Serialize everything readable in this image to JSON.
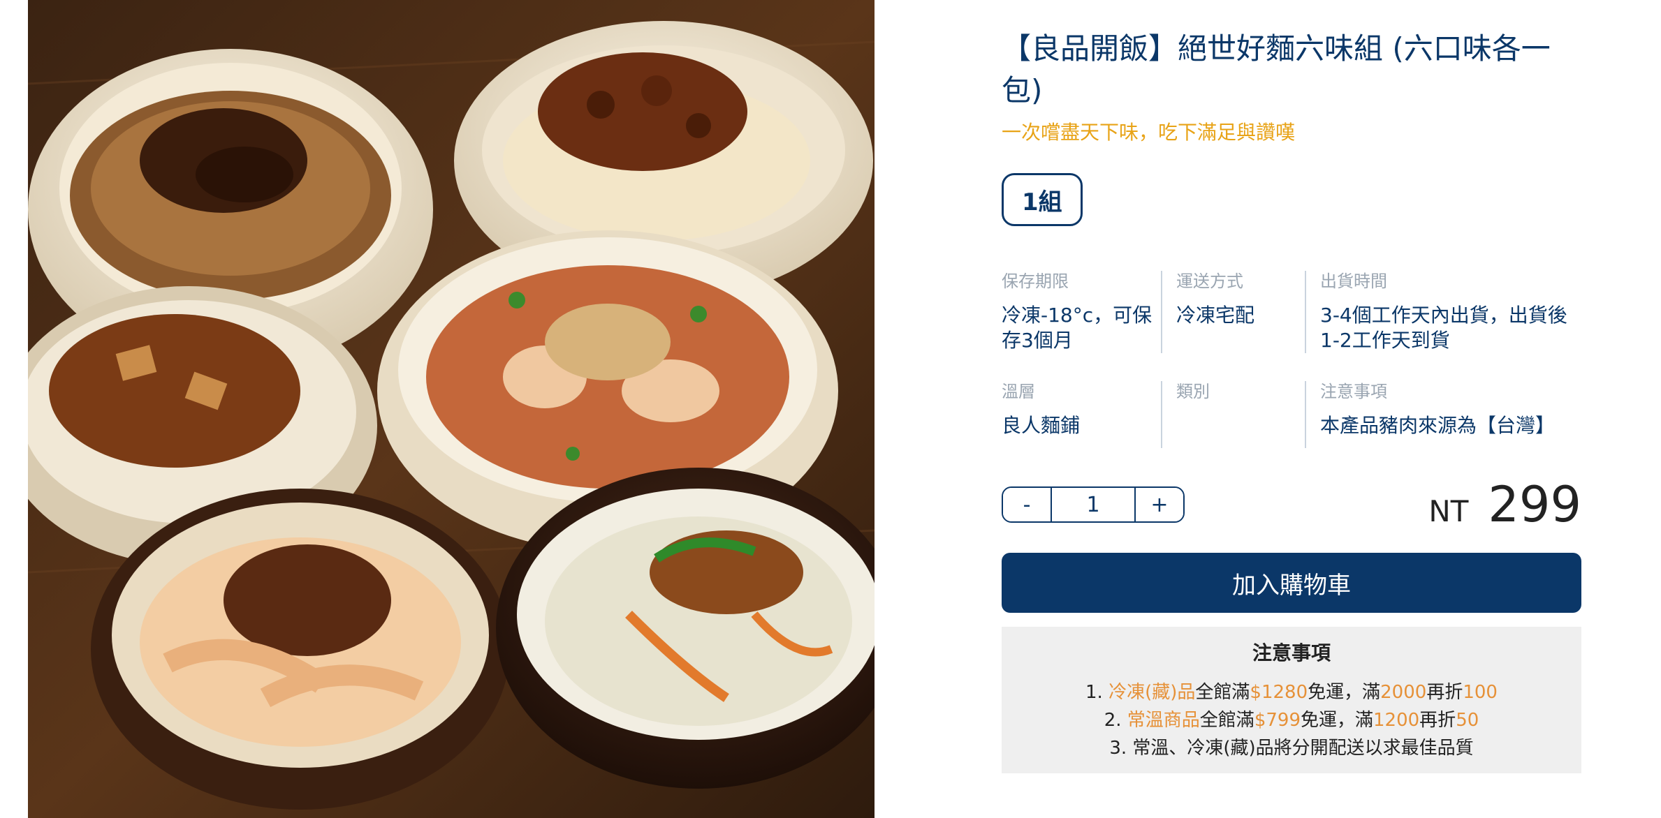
{
  "product": {
    "title": "【良品開飯】絕世好麵六味組 (六口味各一包)",
    "subtitle": "一次嚐盡天下味，吃下滿足與讚嘆",
    "variant": "1組",
    "image_alt": "six bowls of noodles"
  },
  "specs": [
    {
      "label": "保存期限",
      "value": "冷凍-18°c，可保存3個月"
    },
    {
      "label": "運送方式",
      "value": "冷凍宅配"
    },
    {
      "label": "出貨時間",
      "value": "3-4個工作天內出貨，出貨後1-2工作天到貨"
    },
    {
      "label": "溫層",
      "value": "良人麵鋪"
    },
    {
      "label": "類別",
      "value": ""
    },
    {
      "label": "注意事項",
      "value": "本產品豬肉來源為【台灣】"
    }
  ],
  "purchase": {
    "minus": "-",
    "quantity": "1",
    "plus": "+",
    "currency": "NT",
    "price": "299",
    "add_to_cart": "加入購物車"
  },
  "notice": {
    "title": "注意事項",
    "line1": {
      "prefix": "1. ",
      "category": "冷凍(藏)品",
      "text1": "全館滿",
      "threshold": "$1280",
      "text2": "免運，滿",
      "threshold2": "2000",
      "text3": "再折",
      "discount": "100"
    },
    "line2": {
      "prefix": "2. ",
      "category": "常溫商品",
      "text1": "全館滿",
      "threshold": "$799",
      "text2": "免運，滿",
      "threshold2": "1200",
      "text3": "再折",
      "discount": "50"
    },
    "line3": "3. 常溫、冷凍(藏)品將分開配送以求最佳品質"
  },
  "colors": {
    "brand_navy": "#0b3768",
    "accent_orange": "#e69138",
    "subtitle_gold": "#e8a317",
    "notice_bg": "#efefef"
  }
}
